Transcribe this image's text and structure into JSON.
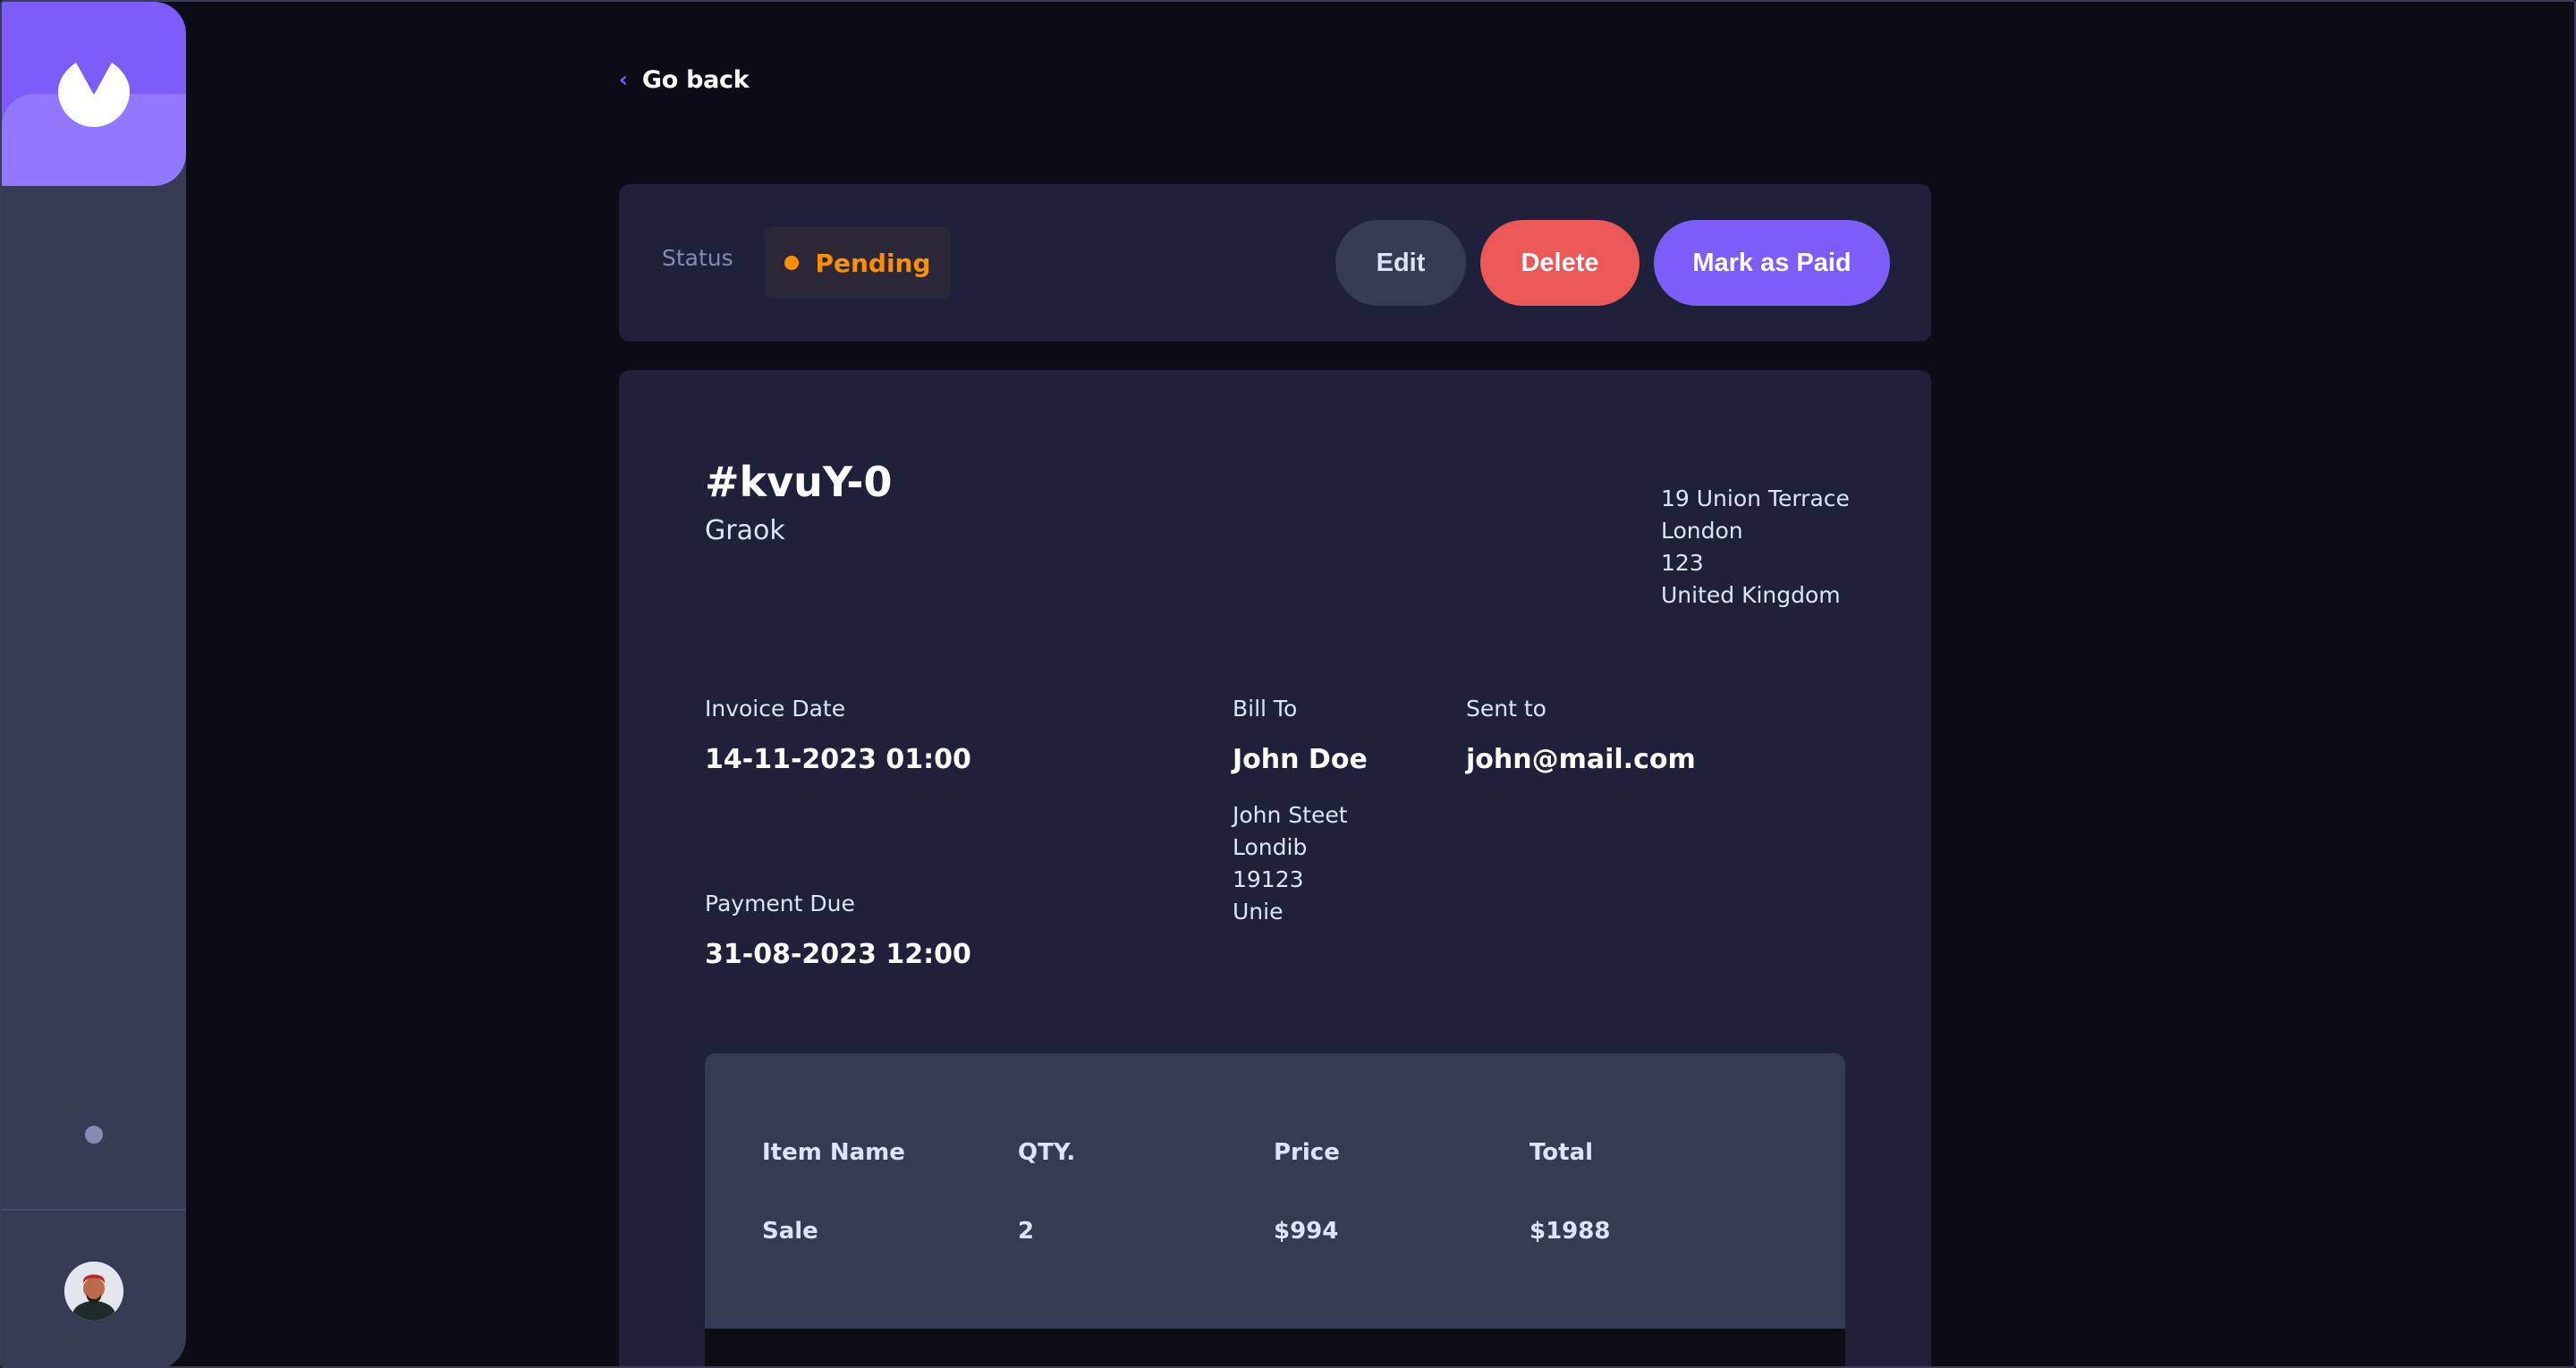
{
  "nav": {
    "go_back": "Go back"
  },
  "status_bar": {
    "status_label": "Status",
    "status_value": "Pending",
    "status_color": "#ff8f00",
    "edit_label": "Edit",
    "delete_label": "Delete",
    "mark_paid_label": "Mark as Paid"
  },
  "invoice": {
    "id": "#kvuY-0",
    "description": "Graok",
    "sender_address": {
      "street": "19 Union Terrace",
      "city": "London",
      "post_code": "123",
      "country": "United Kingdom"
    },
    "invoice_date_label": "Invoice Date",
    "invoice_date": "14-11-2023 01:00",
    "payment_due_label": "Payment Due",
    "payment_due": "31-08-2023 12:00",
    "bill_to_label": "Bill To",
    "client_name": "John Doe",
    "client_address": {
      "street": "John Steet",
      "city": "Londib",
      "post_code": "19123",
      "country": "Unie"
    },
    "sent_to_label": "Sent to",
    "client_email": "john@mail.com"
  },
  "items_table": {
    "headers": [
      "Item Name",
      "QTY.",
      "Price",
      "Total"
    ],
    "rows": [
      {
        "name": "Sale",
        "qty": "2",
        "price": "$994",
        "total": "$1988"
      }
    ]
  },
  "colors": {
    "accent": "#7c5dfa",
    "danger": "#ec5757",
    "pending": "#ff8f00"
  },
  "icons": {
    "logo": "app-logo-icon",
    "back": "chevron-left-icon",
    "theme": "theme-toggle-icon",
    "avatar": "user-avatar"
  }
}
